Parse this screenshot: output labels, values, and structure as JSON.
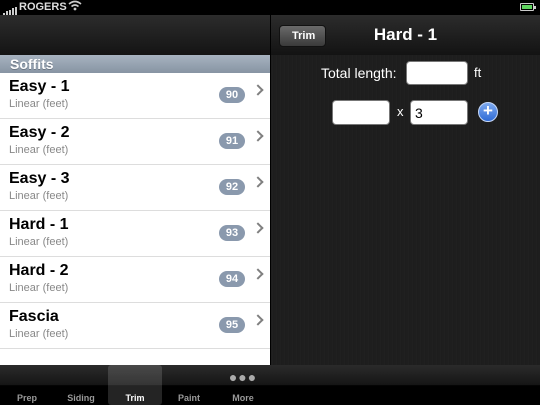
{
  "status_bar": {
    "carrier": "ROGERS",
    "wifi_icon": "wifi-icon",
    "battery_icon": "battery-icon"
  },
  "left_pane": {
    "section_title": "Soffits",
    "items": [
      {
        "title": "Easy - 1",
        "subtitle": "Linear (feet)",
        "badge": "90"
      },
      {
        "title": "Easy - 2",
        "subtitle": "Linear (feet)",
        "badge": "91"
      },
      {
        "title": "Easy - 3",
        "subtitle": "Linear (feet)",
        "badge": "92"
      },
      {
        "title": "Hard - 1",
        "subtitle": "Linear (feet)",
        "badge": "93"
      },
      {
        "title": "Hard - 2",
        "subtitle": "Linear (feet)",
        "badge": "94"
      },
      {
        "title": "Fascia",
        "subtitle": "Linear (feet)",
        "badge": "95"
      }
    ]
  },
  "right_pane": {
    "back_label": "Trim",
    "title": "Hard - 1",
    "total_length_label": "Total length:",
    "total_length_value": "",
    "unit": "ft",
    "multiplier_left": "",
    "times_symbol": "x",
    "multiplier_right": "3"
  },
  "tab_bar": {
    "tabs": [
      {
        "label": "Prep"
      },
      {
        "label": "Siding"
      },
      {
        "label": "Trim"
      },
      {
        "label": "Paint"
      },
      {
        "label": "More"
      }
    ],
    "active": "Trim"
  },
  "colors": {
    "section_header": "#98a5b4",
    "badge": "#8a99ad",
    "add_button": "#2f6bd6"
  }
}
